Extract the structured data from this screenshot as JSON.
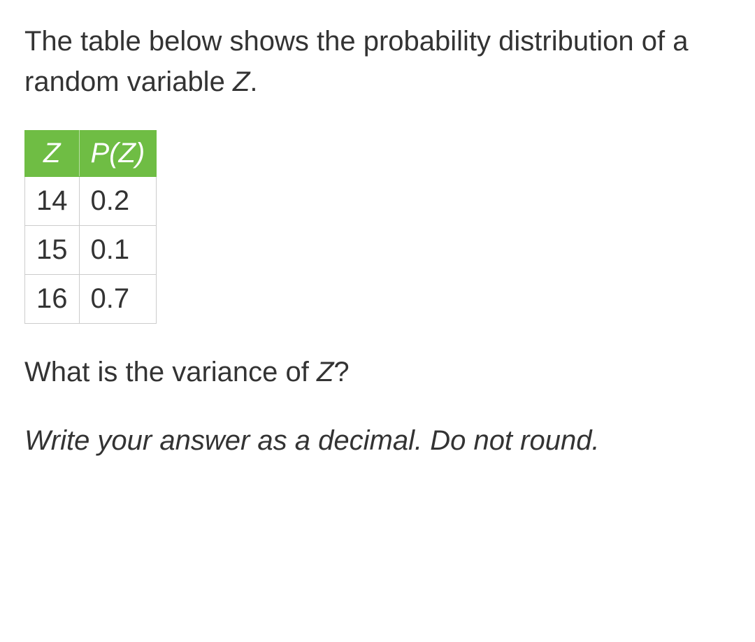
{
  "prompt": {
    "text_before": "The table below shows the probability distribution of a random variable ",
    "variable": "Z",
    "text_after": "."
  },
  "table": {
    "headers": {
      "col1": "Z",
      "col2": "P(Z)"
    },
    "rows": [
      {
        "z": "14",
        "p": "0.2"
      },
      {
        "z": "15",
        "p": "0.1"
      },
      {
        "z": "16",
        "p": "0.7"
      }
    ]
  },
  "question": {
    "text_before": "What is the variance of ",
    "variable": "Z",
    "text_after": "?"
  },
  "instruction": "Write your answer as a decimal. Do not round."
}
